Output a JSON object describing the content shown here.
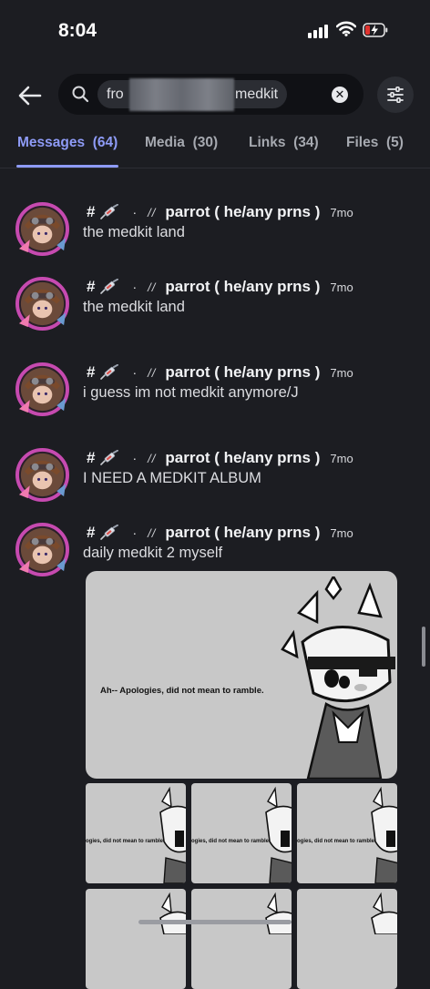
{
  "status_bar": {
    "time": "8:04"
  },
  "search": {
    "from_prefix": "fro",
    "query_term": "medkit"
  },
  "tabs": [
    {
      "label": "Messages",
      "count": "(64)",
      "active": true
    },
    {
      "label": "Media",
      "count": "(30)",
      "active": false
    },
    {
      "label": "Links",
      "count": "(34)",
      "active": false
    },
    {
      "label": "Files",
      "count": "(5)",
      "active": false
    }
  ],
  "messages": [
    {
      "channel": "#",
      "author": "parrot ( he/any prns )",
      "time": "7mo",
      "text": "the medkit land"
    },
    {
      "channel": "#",
      "author": "parrot ( he/any prns )",
      "time": "7mo",
      "text": "the medkit land"
    },
    {
      "channel": "#",
      "author": "parrot ( he/any prns )",
      "time": "7mo",
      "text": "i guess im not medkit anymore/J"
    },
    {
      "channel": "#",
      "author": "parrot ( he/any prns )",
      "time": "7mo",
      "text": "I NEED A MEDKIT ALBUM"
    },
    {
      "channel": "#",
      "author": "parrot ( he/any prns )",
      "time": "7mo",
      "text": "daily medkit 2 myself"
    }
  ],
  "meta_separator": "·",
  "meta_slashes": "//",
  "attachment": {
    "caption": "Ah-- Apologies, did not mean to ramble.",
    "thumb_caption": "ogies, did not mean to ramble."
  },
  "colors": {
    "accent": "#8e9bf6",
    "background": "#1c1d22",
    "avatar_border": "#c64ab0"
  }
}
